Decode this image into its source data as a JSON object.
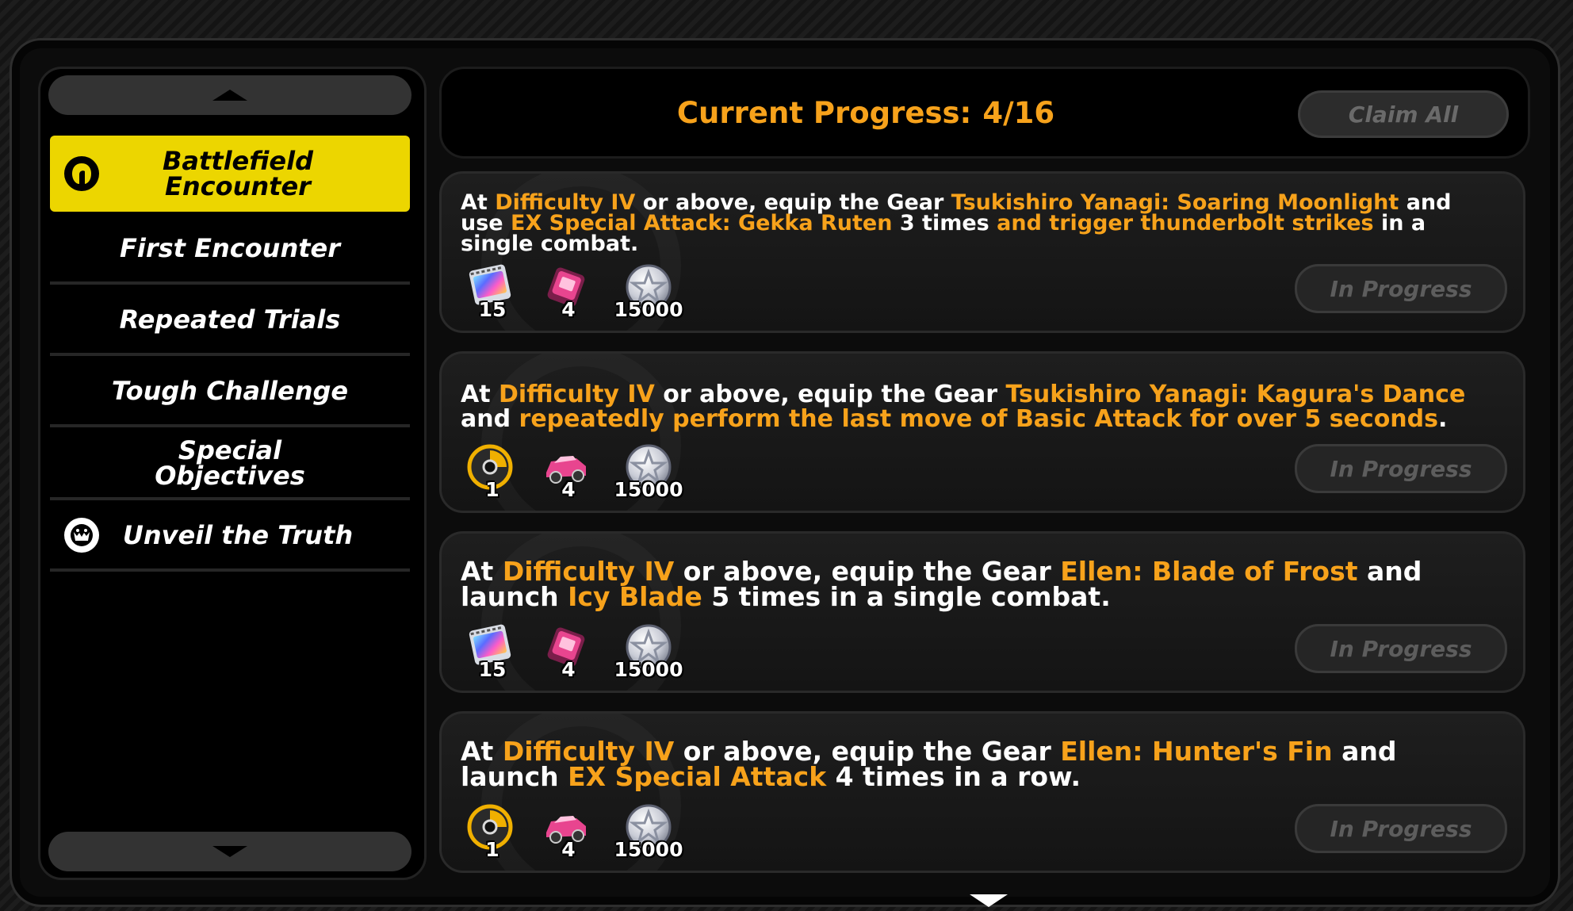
{
  "sidebar": {
    "items": [
      {
        "label": "Battlefield\nEncounter",
        "icon": "helmet-icon",
        "active": true
      },
      {
        "label": "First Encounter"
      },
      {
        "label": "Repeated Trials"
      },
      {
        "label": "Tough Challenge"
      },
      {
        "label": "Special\nObjectives"
      },
      {
        "label": "Unveil the Truth",
        "icon": "monster-face-icon"
      }
    ]
  },
  "header": {
    "progress_label": "Current Progress:",
    "progress_value": "4/16",
    "claim_all": "Claim All"
  },
  "missions": [
    {
      "parts": [
        {
          "t": "At "
        },
        {
          "t": "Difficulty IV",
          "hl": true
        },
        {
          "t": " or above, equip the Gear "
        },
        {
          "t": "Tsukishiro Yanagi: Soaring Moonlight",
          "hl": true
        },
        {
          "t": " and use "
        },
        {
          "t": "EX Special Attack: Gekka Ruten",
          "hl": true
        },
        {
          "t": " 3 times "
        },
        {
          "t": "and trigger thunderbolt strikes",
          "hl": true
        },
        {
          "t": " in a single combat."
        }
      ],
      "rewards": [
        {
          "icon": "film-icon",
          "qty": "15"
        },
        {
          "icon": "chip-icon",
          "qty": "4"
        },
        {
          "icon": "star-coin-icon",
          "qty": "15000"
        }
      ],
      "status": "In Progress"
    },
    {
      "parts": [
        {
          "t": "At "
        },
        {
          "t": "Difficulty IV",
          "hl": true
        },
        {
          "t": " or above, equip the Gear "
        },
        {
          "t": "Tsukishiro Yanagi: Kagura's Dance",
          "hl": true
        },
        {
          "t": " and "
        },
        {
          "t": "repeatedly perform the last move of Basic Attack for over 5 seconds",
          "hl": true
        },
        {
          "t": "."
        }
      ],
      "rewards": [
        {
          "icon": "drive-disc-icon",
          "qty": "1"
        },
        {
          "icon": "car-icon",
          "qty": "4"
        },
        {
          "icon": "star-coin-icon",
          "qty": "15000"
        }
      ],
      "status": "In Progress"
    },
    {
      "parts": [
        {
          "t": "At "
        },
        {
          "t": "Difficulty IV",
          "hl": true
        },
        {
          "t": " or above, equip the Gear "
        },
        {
          "t": "Ellen: Blade of Frost",
          "hl": true
        },
        {
          "t": " and launch "
        },
        {
          "t": "Icy Blade",
          "hl": true
        },
        {
          "t": " 5 times in a single combat."
        }
      ],
      "rewards": [
        {
          "icon": "film-icon",
          "qty": "15"
        },
        {
          "icon": "chip-icon",
          "qty": "4"
        },
        {
          "icon": "star-coin-icon",
          "qty": "15000"
        }
      ],
      "status": "In Progress"
    },
    {
      "parts": [
        {
          "t": "At "
        },
        {
          "t": "Difficulty IV",
          "hl": true
        },
        {
          "t": " or above, equip the Gear "
        },
        {
          "t": "Ellen: Hunter's Fin",
          "hl": true
        },
        {
          "t": " and launch "
        },
        {
          "t": "EX Special Attack",
          "hl": true
        },
        {
          "t": " 4 times in a row."
        }
      ],
      "rewards": [
        {
          "icon": "drive-disc-icon",
          "qty": "1"
        },
        {
          "icon": "car-icon",
          "qty": "4"
        },
        {
          "icon": "star-coin-icon",
          "qty": "15000"
        }
      ],
      "status": "In Progress"
    }
  ],
  "colors": {
    "accent": "#f7a21b",
    "active_tab": "#ecd600"
  }
}
